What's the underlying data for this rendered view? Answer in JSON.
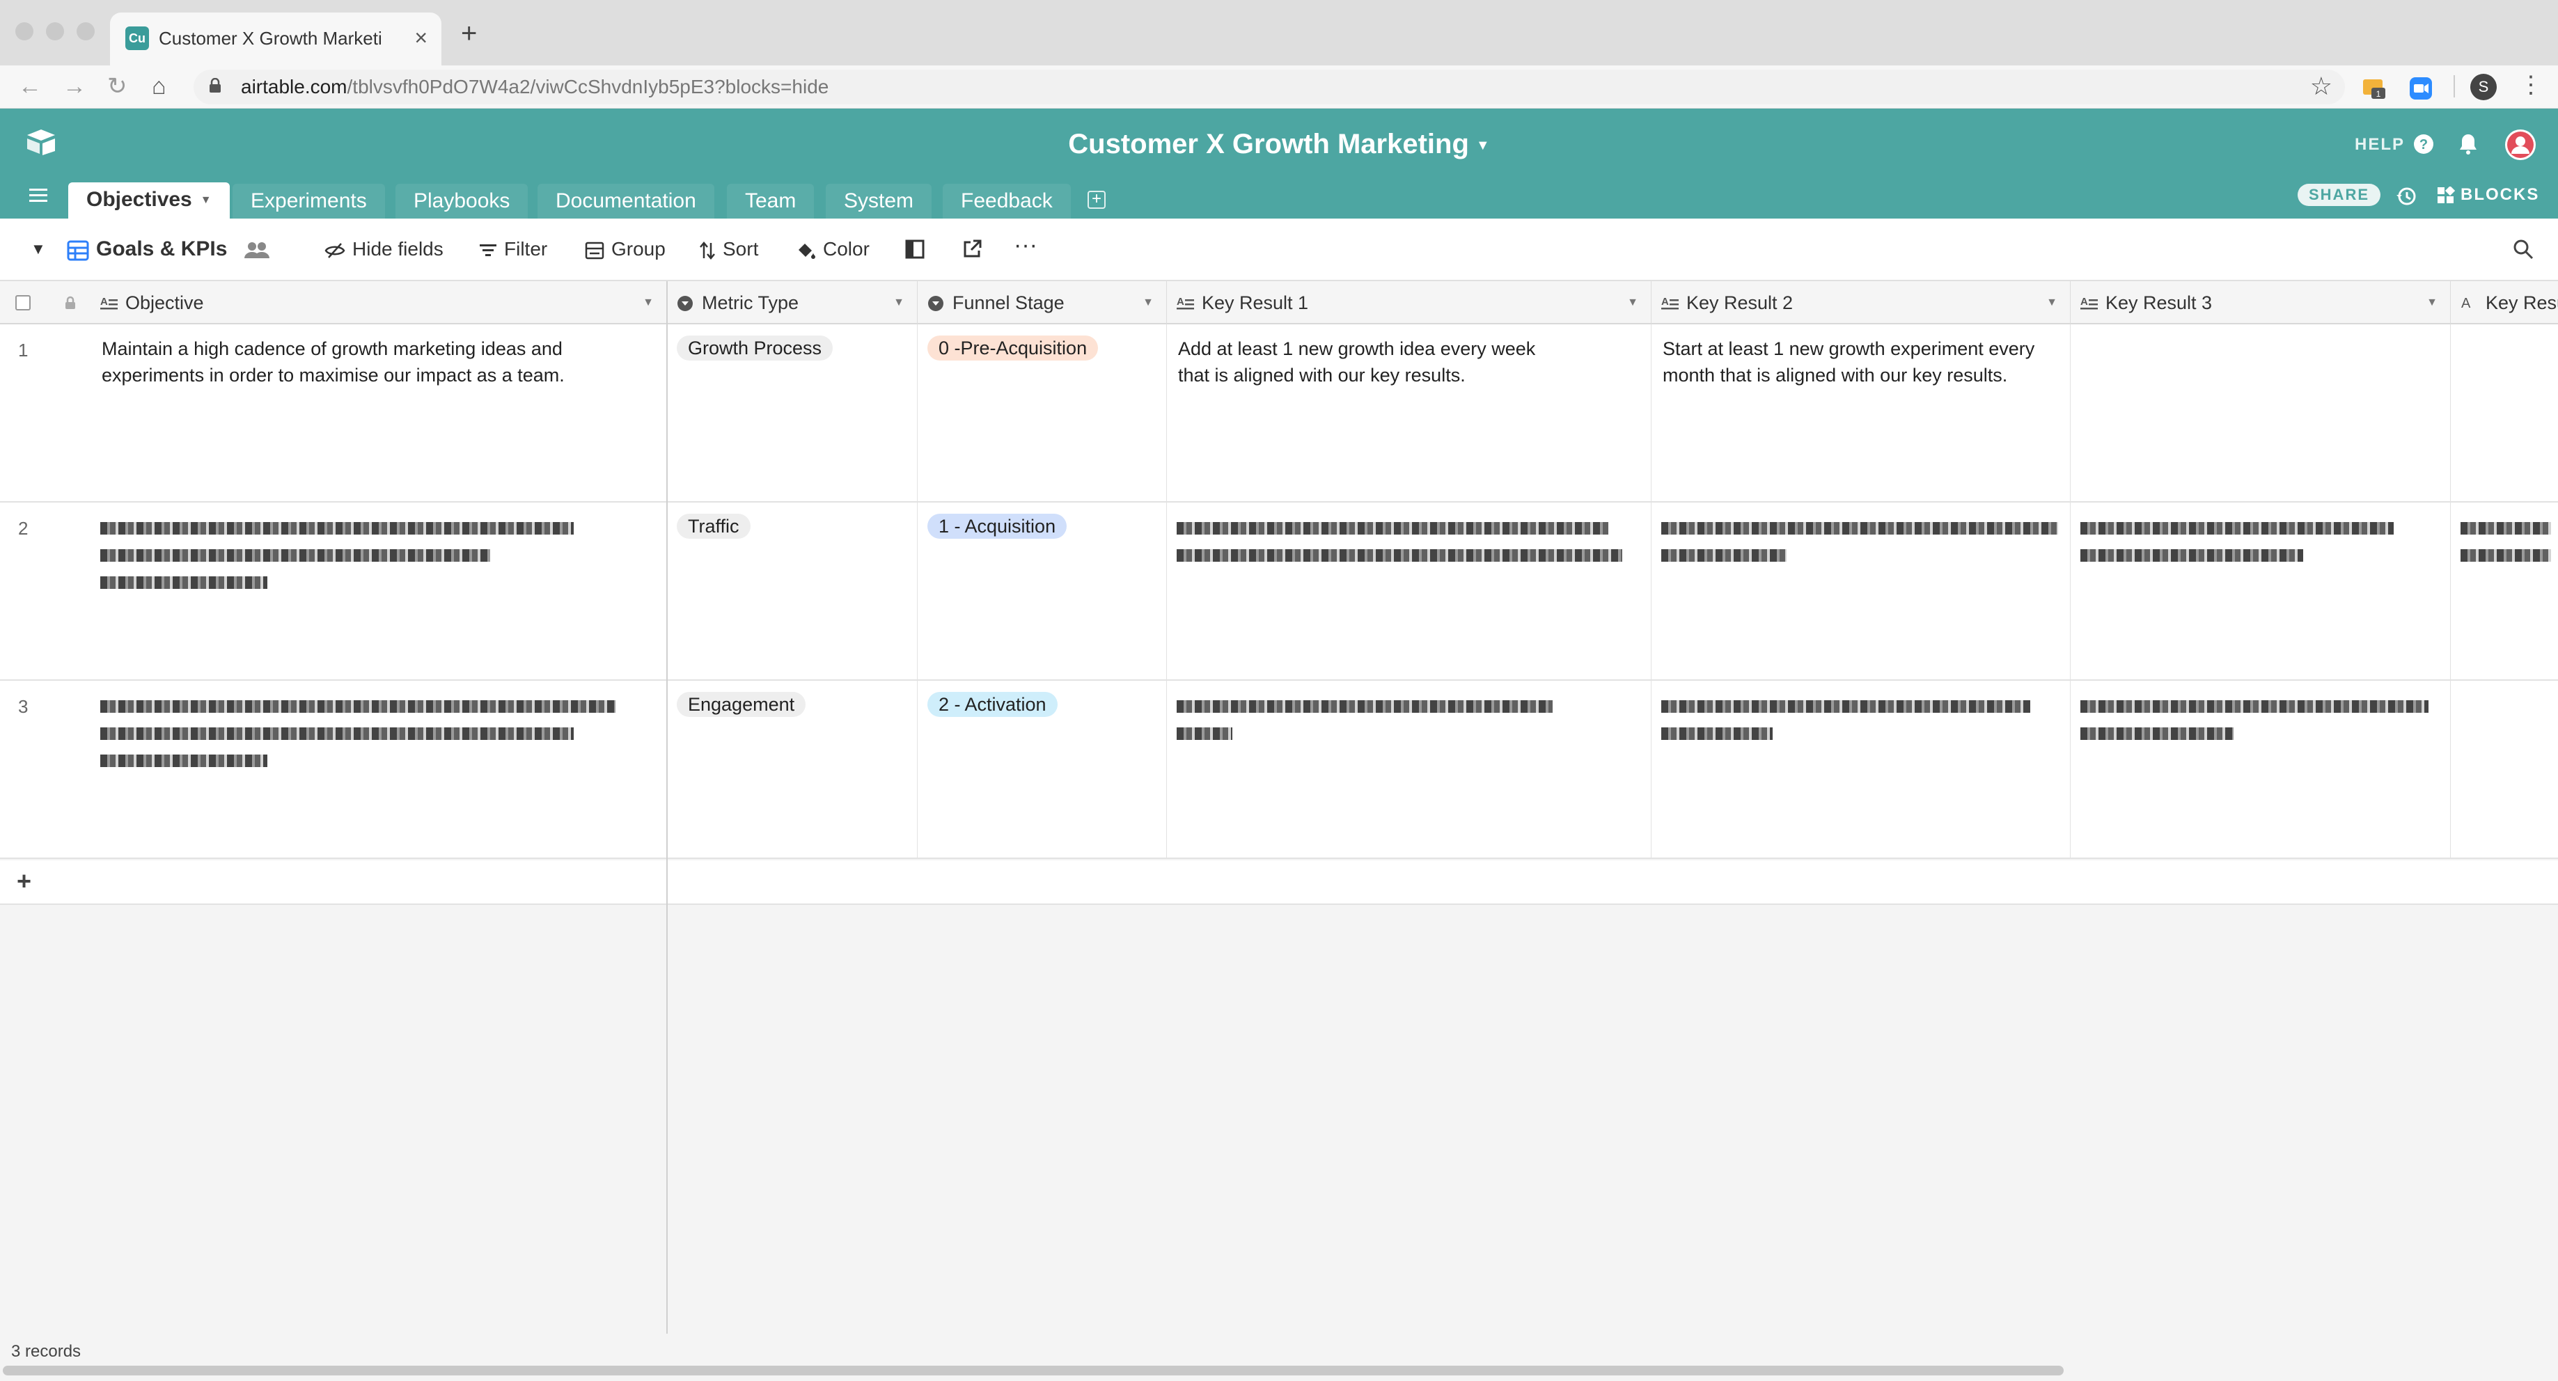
{
  "browser": {
    "tab_title": "Customer X Growth Marketing:",
    "favicon_text": "Cu",
    "url_host": "airtable.com",
    "url_path": "/tblvsvfh0PdO7W4a2/viwCcShvdnIyb5pE3?blocks=hide",
    "profile_initial": "S",
    "extension_badge": "1"
  },
  "app": {
    "base_title": "Customer X Growth Marketing",
    "help_label": "HELP",
    "share_label": "SHARE",
    "blocks_label": "BLOCKS",
    "accent": "#4da6a2",
    "tables": [
      {
        "label": "Objectives",
        "active": true
      },
      {
        "label": "Experiments"
      },
      {
        "label": "Playbooks"
      },
      {
        "label": "Documentation"
      },
      {
        "label": "Team"
      },
      {
        "label": "System"
      },
      {
        "label": "Feedback"
      }
    ]
  },
  "viewbar": {
    "view_name": "Goals & KPIs",
    "hide_fields": "Hide fields",
    "filter": "Filter",
    "group": "Group",
    "sort": "Sort",
    "color": "Color"
  },
  "grid": {
    "columns": [
      {
        "label": "Objective",
        "icon": "long-text-icon"
      },
      {
        "label": "Metric Type",
        "icon": "single-select-icon"
      },
      {
        "label": "Funnel Stage",
        "icon": "single-select-icon"
      },
      {
        "label": "Key Result 1",
        "icon": "long-text-icon"
      },
      {
        "label": "Key Result 2",
        "icon": "long-text-icon"
      },
      {
        "label": "Key Result 3",
        "icon": "long-text-icon"
      },
      {
        "label": "Key Resu",
        "icon": "text-icon"
      }
    ],
    "rows": [
      {
        "num": "1",
        "objective": "Maintain a high cadence of growth marketing ideas and experiments in order to maximise our impact as a team.",
        "metric_type": "Growth Process",
        "funnel_stage": "0 -Pre-Acquisition",
        "funnel_color": "#fde2d4",
        "kr1": "Add at least 1 new growth idea every week that is aligned with our key results.",
        "kr2": "Start at least 1 new growth experiment every month that is aligned with our key results."
      },
      {
        "num": "2",
        "metric_type": "Traffic",
        "funnel_stage": "1 - Acquisition",
        "funnel_color": "#d0dffb"
      },
      {
        "num": "3",
        "metric_type": "Engagement",
        "funnel_stage": "2 - Activation",
        "funnel_color": "#cfeefb"
      }
    ],
    "record_count": "3 records"
  }
}
